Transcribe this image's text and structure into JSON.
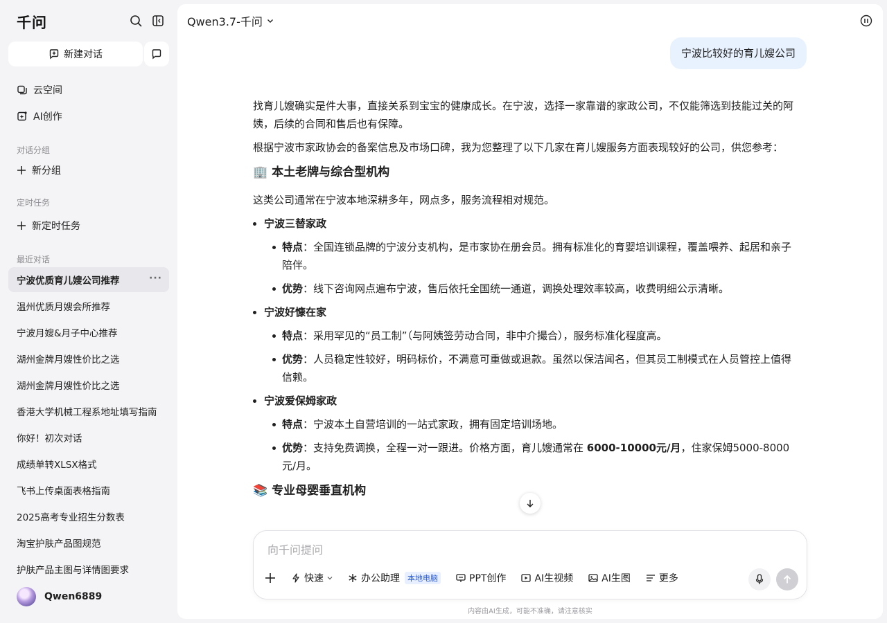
{
  "sidebar": {
    "logo": "千问",
    "new_chat_label": "新建对话",
    "nav": [
      {
        "label": "云空间",
        "icon": "cloud-space-icon"
      },
      {
        "label": "AI创作",
        "icon": "ai-create-icon"
      }
    ],
    "group_section_label": "对话分组",
    "new_group_label": "新分组",
    "scheduled_section_label": "定时任务",
    "new_scheduled_label": "新定时任务",
    "recent_section_label": "最近对话",
    "history": [
      {
        "label": "宁波优质育儿嫂公司推荐",
        "active": true
      },
      {
        "label": "温州优质月嫂会所推荐"
      },
      {
        "label": "宁波月嫂&月子中心推荐"
      },
      {
        "label": "湖州金牌月嫂性价比之选"
      },
      {
        "label": "湖州金牌月嫂性价比之选"
      },
      {
        "label": "香港大学机械工程系地址填写指南"
      },
      {
        "label": "你好！初次对话"
      },
      {
        "label": "成绩单转XLSX格式"
      },
      {
        "label": "飞书上传桌面表格指南"
      },
      {
        "label": "2025高考专业招生分数表"
      },
      {
        "label": "淘宝护肤产品图规范"
      },
      {
        "label": "护肤产品主图与详情图要求"
      }
    ],
    "more_dots": "···",
    "username": "Qwen6889"
  },
  "header": {
    "model": "Qwen3.7-千问"
  },
  "chat": {
    "user_message": "宁波比较好的育儿嫂公司",
    "intro_1": "找育儿嫂确实是件大事，直接关系到宝宝的健康成长。在宁波，选择一家靠谱的家政公司，不仅能筛选到技能过关的阿姨，后续的合同和售后也有保障。",
    "intro_2": "根据宁波市家政协会的备案信息及市场口碑，我为您整理了以下几家在育儿嫂服务方面表现较好的公司，供您参考：",
    "section1_emoji": "🏢",
    "section1_title": "本土老牌与综合型机构",
    "section1_desc": "这类公司通常在宁波本地深耕多年，网点多，服务流程相对规范。",
    "companies": [
      {
        "name": "宁波三替家政",
        "features_label": "特点",
        "features": "：全国连锁品牌的宁波分支机构，是市家协在册会员。拥有标准化的育婴培训课程，覆盖喂养、起居和亲子陪伴。",
        "advantages_label": "优势",
        "advantages": "：线下咨询网点遍布宁波，售后依托全国统一通道，调换处理效率较高，收费明细公示清晰。"
      },
      {
        "name": "宁波好慷在家",
        "features_label": "特点",
        "features": "：采用罕见的“员工制”（与阿姨签劳动合同，非中介撮合），服务标准化程度高。",
        "advantages_label": "优势",
        "advantages": "：人员稳定性较好，明码标价，不满意可重做或退款。虽然以保洁闻名，但其员工制模式在人员管控上值得信赖。"
      },
      {
        "name": "宁波爱保姆家政",
        "features_label": "特点",
        "features": "：宁波本土自营培训的一站式家政，拥有固定培训场地。",
        "advantages_label": "优势",
        "advantages_pre": "：支持免费调换，全程一对一跟进。价格方面，育儿嫂通常在 ",
        "advantages_bold": "6000-10000元/月",
        "advantages_post": "，住家保姆5000-8000元/月。"
      }
    ],
    "section2_emoji": "📚",
    "section2_title": "专业母婴垂直机构"
  },
  "composer": {
    "placeholder": "向千问提问",
    "tools": {
      "quick": "快速",
      "office": "办公助理",
      "office_badge": "本地电脑",
      "ppt": "PPT创作",
      "video": "AI生视频",
      "image": "AI生图",
      "more": "更多"
    },
    "disclaimer": "内容由AI生成，可能不准确，请注意核实"
  }
}
